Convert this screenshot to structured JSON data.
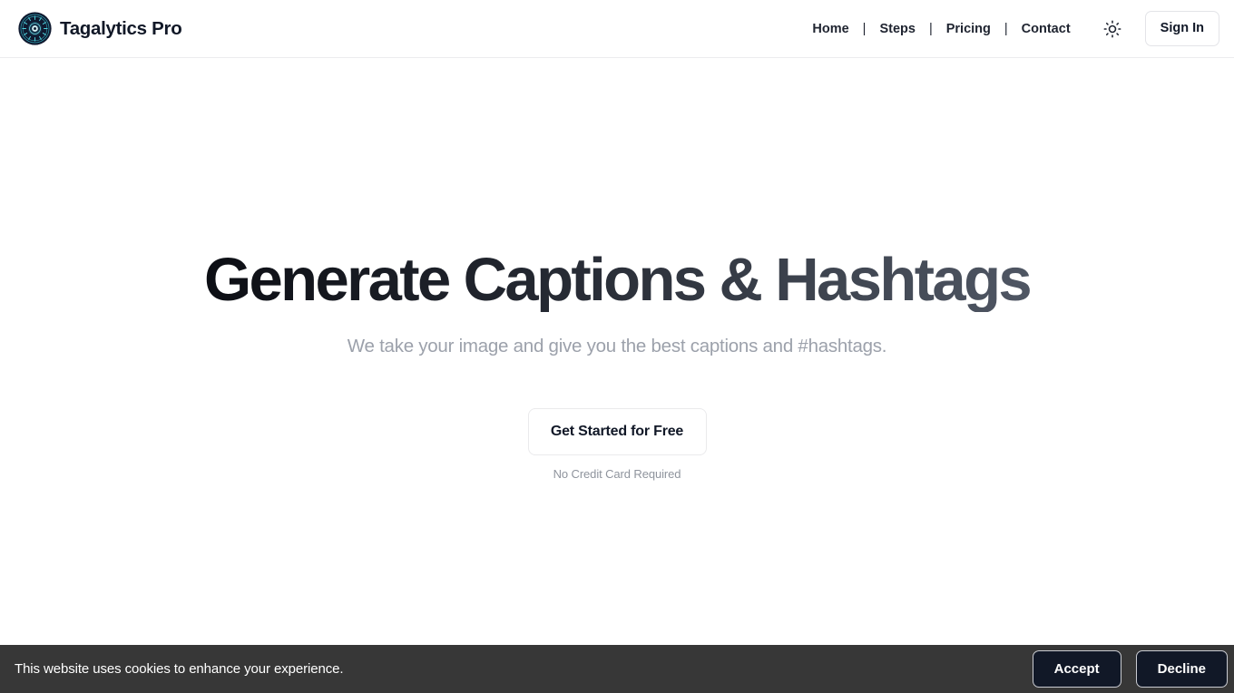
{
  "header": {
    "logo_icon": "tagalytics-disc-logo",
    "brand_name": "Tagalytics Pro",
    "nav": [
      {
        "label": "Home",
        "icon": ""
      },
      {
        "label": "Steps",
        "icon": ""
      },
      {
        "label": "Pricing",
        "icon": ""
      },
      {
        "label": "Contact",
        "icon": ""
      }
    ],
    "separator": "|",
    "theme_toggle_icon": "sun-icon",
    "signin_label": "Sign In"
  },
  "hero": {
    "title": "Generate Captions & Hashtags",
    "subtitle": "We take your image and give you the best captions and #hashtags.",
    "cta_label": "Get Started for Free",
    "cta_note": "No Credit Card Required"
  },
  "cookie_banner": {
    "message": "This website uses cookies to enhance your experience.",
    "accept_label": "Accept",
    "decline_label": "Decline"
  },
  "colors": {
    "page_background": "#ffffff",
    "header_border": "#ececee",
    "text_primary": "#111827",
    "text_muted": "#9ca1ab",
    "heading_gradient_start": "#0c0e14",
    "heading_gradient_end": "#4f5663",
    "cookie_banner_background": "#373737",
    "cookie_button_background": "#111827",
    "logo_teal": "#2e9fb0",
    "logo_navy": "#111c35"
  }
}
